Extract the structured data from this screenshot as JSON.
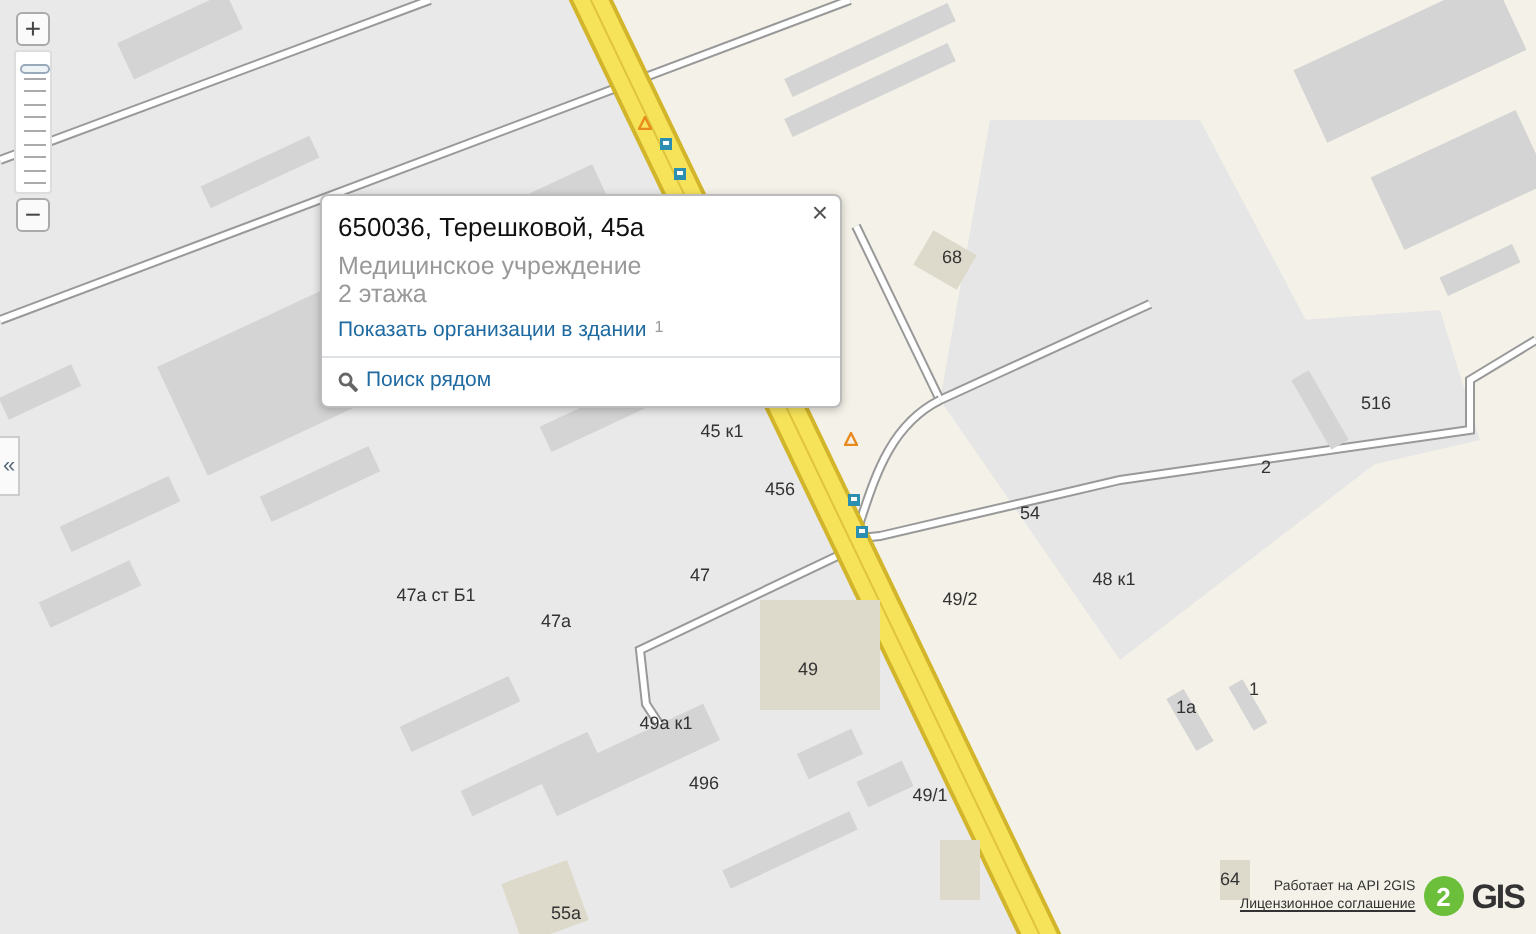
{
  "zoom": {
    "plus": "+",
    "minus": "−",
    "level": 0.9
  },
  "collapse": "«",
  "popup": {
    "close": "×",
    "title": "650036, Терешковой, 45а",
    "category": "Медицинское учреждение",
    "floors": "2 этажа",
    "link": "Показать организации в здании",
    "link_count": "1",
    "nearby": "Поиск рядом"
  },
  "buildings": [
    {
      "label": "68"
    },
    {
      "label": "45 к1"
    },
    {
      "label": "456"
    },
    {
      "label": "54"
    },
    {
      "label": "516"
    },
    {
      "label": "2"
    },
    {
      "label": "47"
    },
    {
      "label": "48 к1"
    },
    {
      "label": "47а ст Б1"
    },
    {
      "label": "49/2"
    },
    {
      "label": "47а"
    },
    {
      "label": "49"
    },
    {
      "label": "1"
    },
    {
      "label": "1а"
    },
    {
      "label": "49а к1"
    },
    {
      "label": "496"
    },
    {
      "label": "49/1"
    },
    {
      "label": "64"
    },
    {
      "label": "55а"
    }
  ],
  "footer": {
    "powered": "Работает на API 2GIS",
    "license": "Лицензионное соглашение",
    "logo_digit": "2",
    "logo_text": "GIS"
  }
}
